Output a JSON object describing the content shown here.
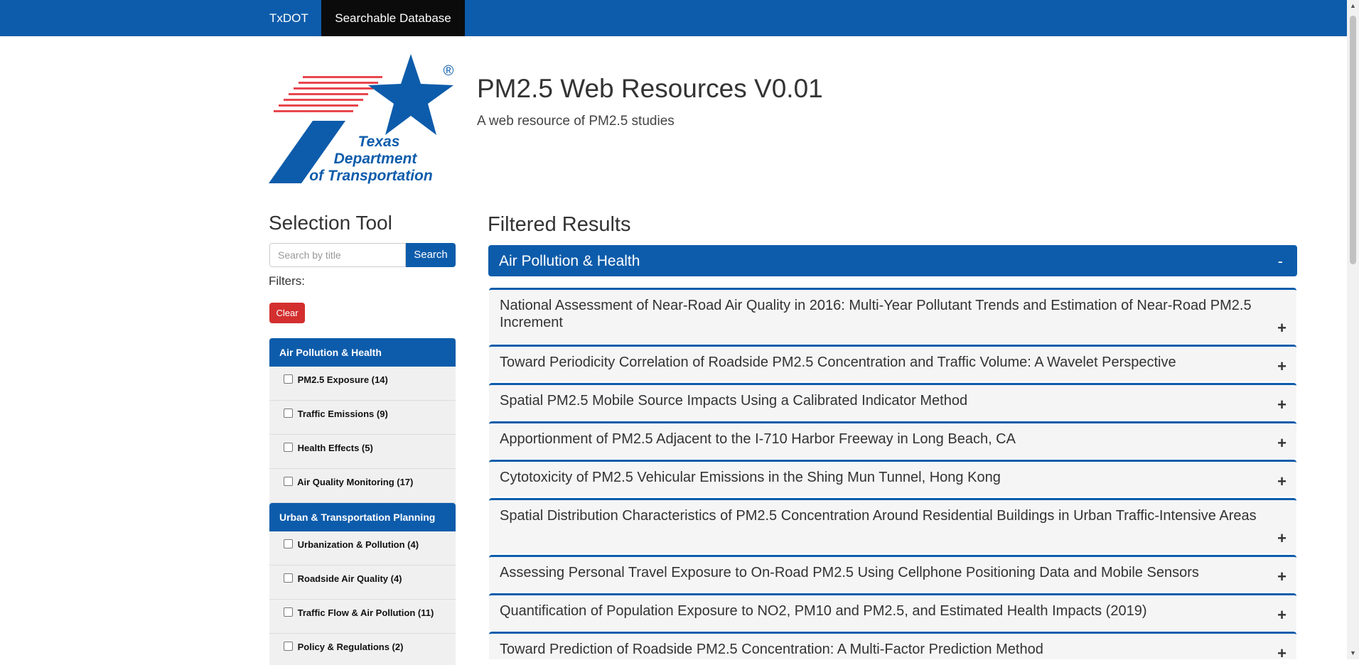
{
  "nav": {
    "brand": "TxDOT",
    "active": "Searchable Database"
  },
  "logo": {
    "line1": "Texas",
    "line2": "Department",
    "line3": "of Transportation",
    "mark": "®"
  },
  "header": {
    "title": "PM2.5 Web Resources V0.01",
    "subtitle": "A web resource of PM2.5 studies"
  },
  "sidebar": {
    "title": "Selection Tool",
    "search_placeholder": "Search by title",
    "search_button": "Search",
    "filters_label": "Filters:",
    "clear_button": "Clear",
    "groups": [
      {
        "label": "Air Pollution & Health",
        "items": [
          "PM2.5 Exposure (14)",
          "Traffic Emissions (9)",
          "Health Effects (5)",
          "Air Quality Monitoring (17)"
        ]
      },
      {
        "label": "Urban & Transportation Planning",
        "items": [
          "Urbanization & Pollution (4)",
          "Roadside Air Quality (4)",
          "Traffic Flow & Air Pollution (11)",
          "Policy & Regulations (2)"
        ]
      }
    ]
  },
  "results": {
    "title": "Filtered Results",
    "category": "Air Pollution & Health",
    "category_toggle": "-",
    "expand_symbol": "+",
    "items": [
      "National Assessment of Near-Road Air Quality in 2016: Multi-Year Pollutant Trends and Estimation of Near-Road PM2.5 Increment",
      "Toward Periodicity Correlation of Roadside PM2.5 Concentration and Traffic Volume: A Wavelet Perspective",
      "Spatial PM2.5 Mobile Source Impacts Using a Calibrated Indicator Method",
      "Apportionment of PM2.5 Adjacent to the I-710 Harbor Freeway in Long Beach, CA",
      "Cytotoxicity of PM2.5 Vehicular Emissions in the Shing Mun Tunnel, Hong Kong",
      "Spatial Distribution Characteristics of PM2.5 Concentration Around Residential Buildings in Urban Traffic-Intensive Areas",
      "Assessing Personal Travel Exposure to On-Road PM2.5 Using Cellphone Positioning Data and Mobile Sensors",
      "Quantification of Population Exposure to NO2, PM10 and PM2.5, and Estimated Health Impacts (2019)",
      "Toward Prediction of Roadside PM2.5 Concentration: A Multi-Factor Prediction Method"
    ]
  },
  "colors": {
    "primary": "#0d5cab",
    "danger": "#d32f2f",
    "nav_active": "#0b0b0b"
  }
}
